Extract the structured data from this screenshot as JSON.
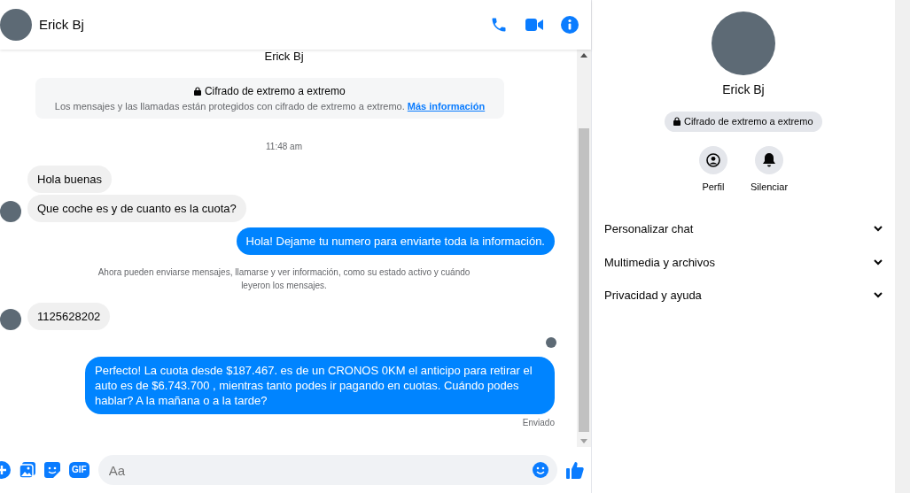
{
  "header": {
    "name": "Erick Bj"
  },
  "conversation": {
    "heading": "Erick Bj",
    "encryption": {
      "title": "Cifrado de extremo a extremo",
      "text": "Los mensajes y las llamadas están protegidos con cifrado de extremo a extremo.",
      "link": "Más información"
    },
    "items": [
      {
        "kind": "time",
        "text": "11:48 am"
      },
      {
        "kind": "incoming",
        "text": "Hola buenas",
        "avatar": false
      },
      {
        "kind": "incoming",
        "text": "Que coche es y de cuanto es la cuota?",
        "avatar": true
      },
      {
        "kind": "outgoing",
        "text": "Hola! Dejame tu numero  para enviarte toda la información."
      },
      {
        "kind": "notice",
        "text": "Ahora pueden enviarse mensajes, llamarse y ver información, como su estado activo y cuándo leyeron los mensajes."
      },
      {
        "kind": "incoming",
        "text": "1125628202",
        "avatar": true
      },
      {
        "kind": "seen"
      },
      {
        "kind": "outgoing",
        "text": "Perfecto! La cuota desde $187.467. es de un CRONOS 0KM el anticipo para retirar el auto es de $6.743.700 , mientras tanto podes ir pagando en cuotas. Cuándo podes hablar? A la mañana o a la tarde?"
      },
      {
        "kind": "status",
        "text": "Enviado"
      }
    ]
  },
  "composer": {
    "gif_label": "GIF",
    "placeholder": "Aa"
  },
  "panel": {
    "name": "Erick Bj",
    "badge": "Cifrado de extremo a extremo",
    "actions": [
      {
        "kind": "profile",
        "label": "Perfil"
      },
      {
        "kind": "mute",
        "label": "Silenciar"
      }
    ],
    "sections": [
      {
        "label": "Personalizar chat",
        "expanded": false
      },
      {
        "label": "Multimedia y archivos",
        "expanded": false
      },
      {
        "label": "Privacidad y ayuda",
        "expanded": false
      }
    ]
  }
}
